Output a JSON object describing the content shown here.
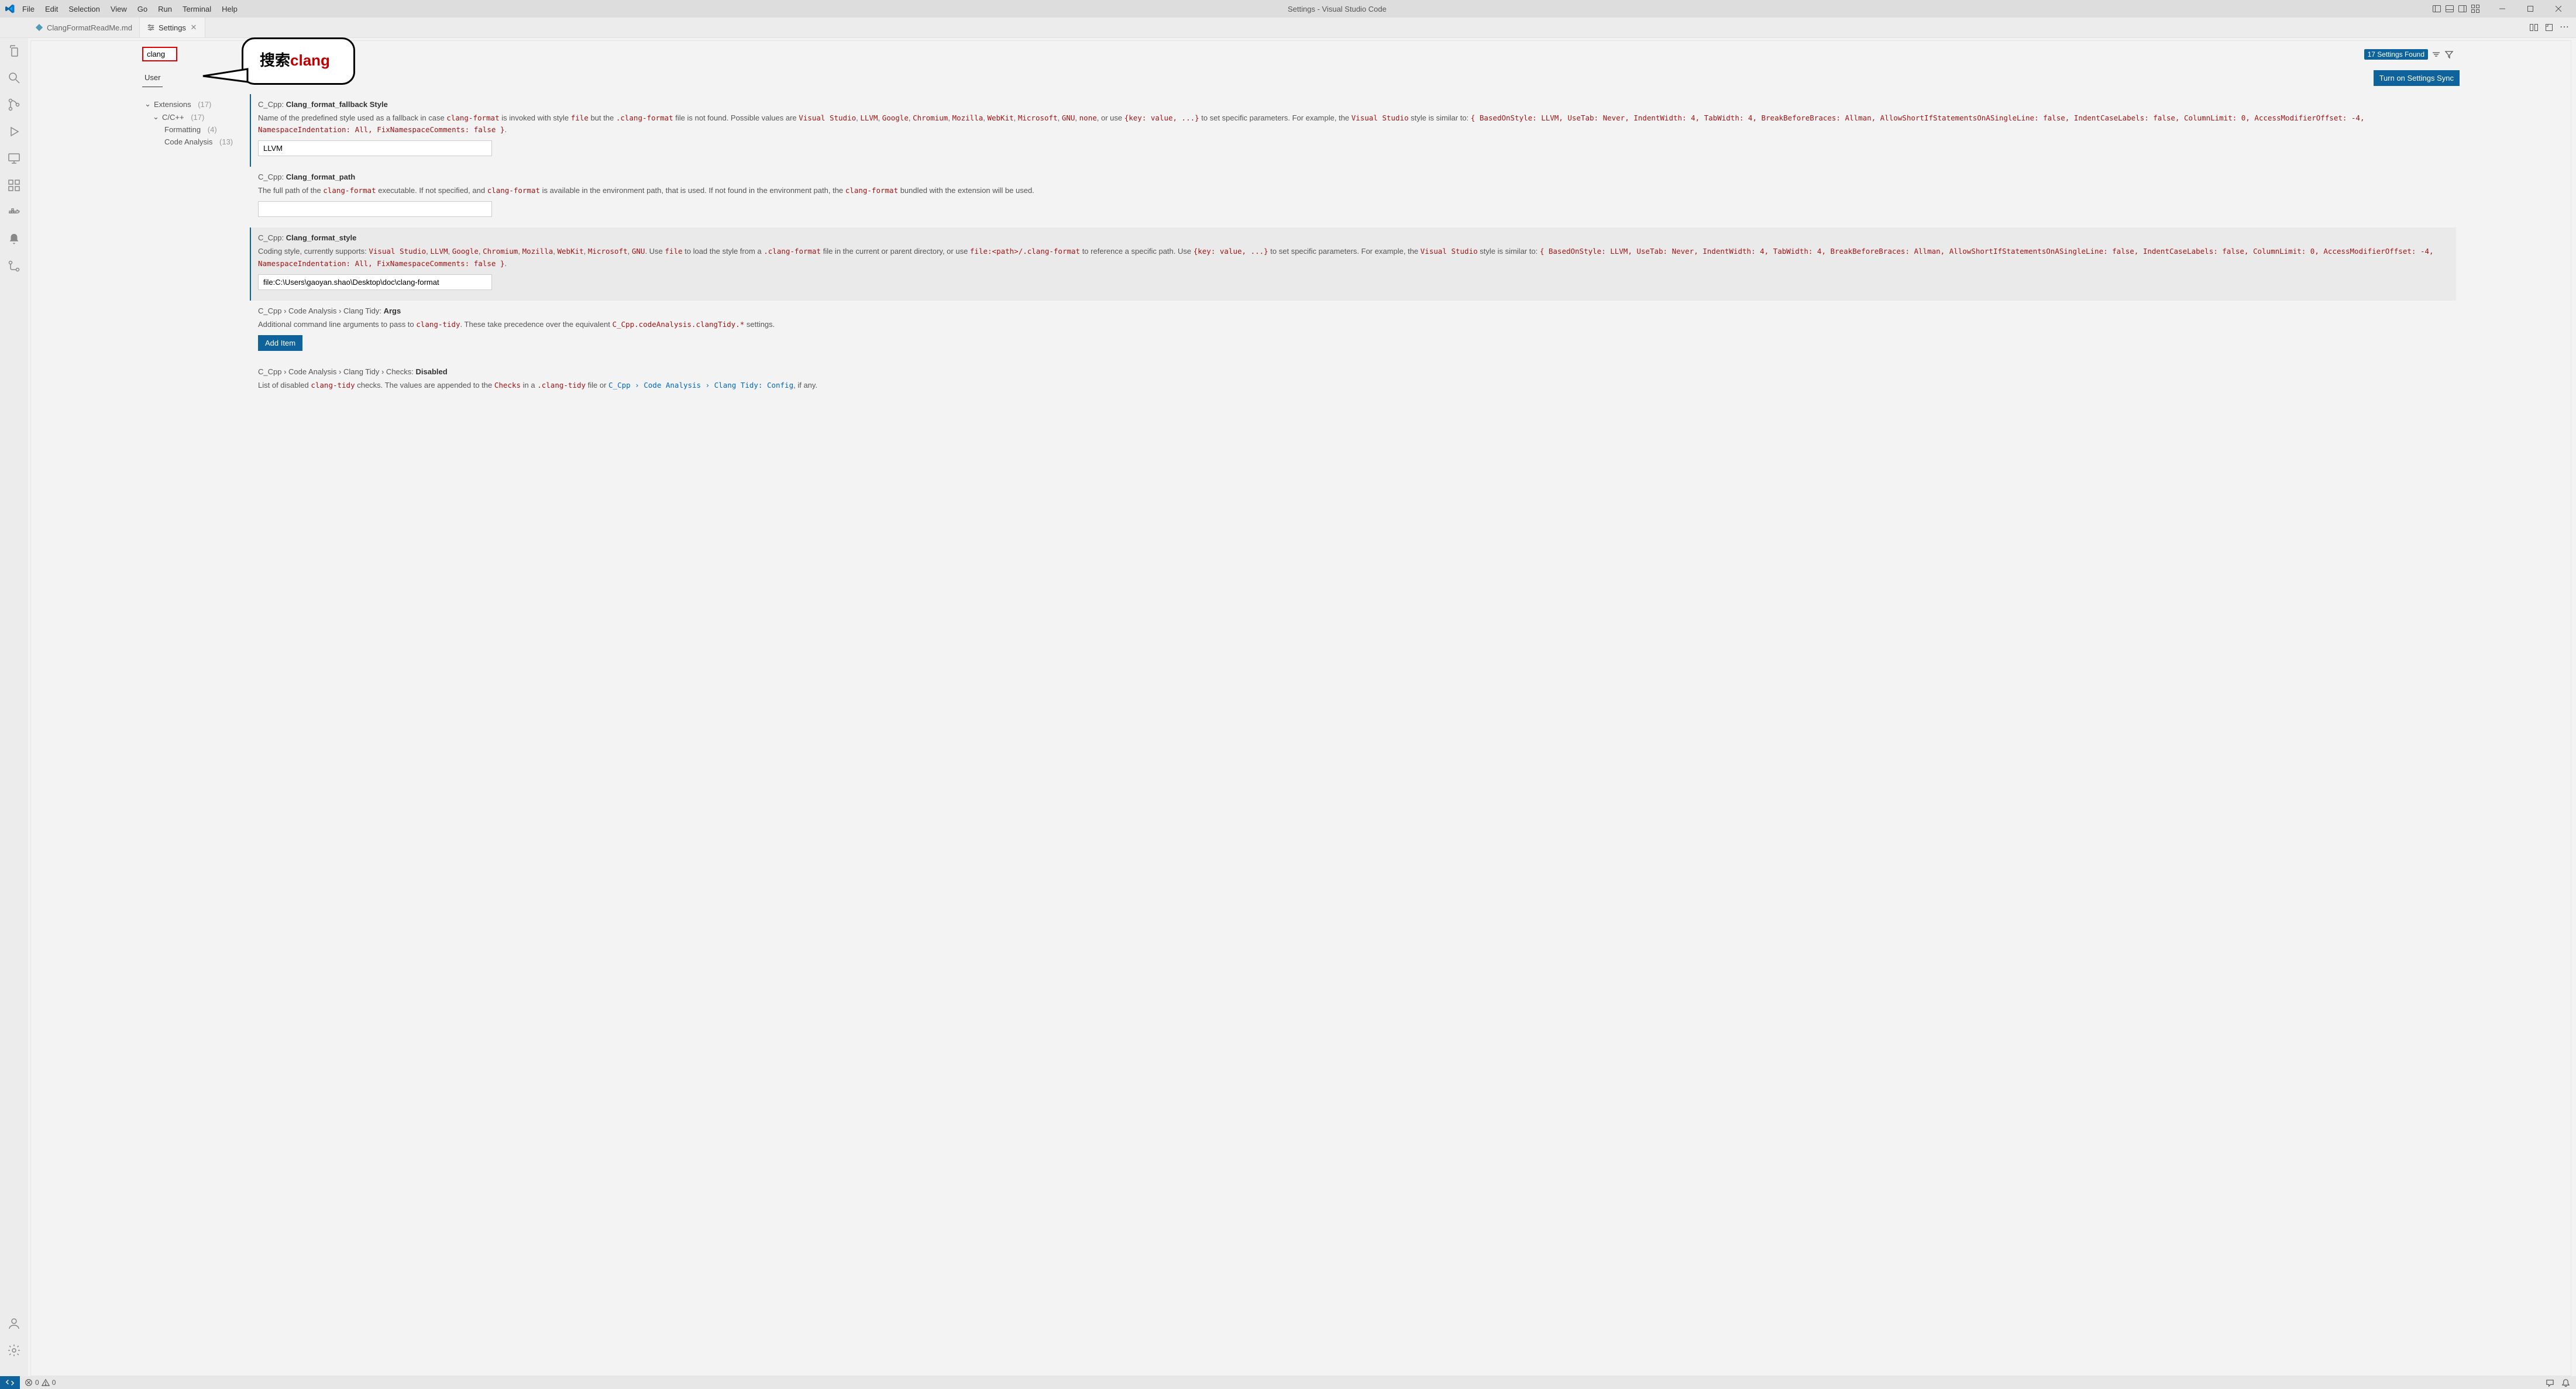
{
  "title_bar": {
    "menu": [
      "File",
      "Edit",
      "Selection",
      "View",
      "Go",
      "Run",
      "Terminal",
      "Help"
    ],
    "window_title": "Settings - Visual Studio Code"
  },
  "tabs": {
    "items": [
      {
        "label": "ClangFormatReadMe.md",
        "active": false
      },
      {
        "label": "Settings",
        "active": true
      }
    ]
  },
  "callout": {
    "prefix": "搜索",
    "keyword": "clang"
  },
  "search": {
    "value": "clang",
    "found_label": "17 Settings Found"
  },
  "scope": {
    "user": "User",
    "sync_button": "Turn on Settings Sync"
  },
  "tree": {
    "extensions": {
      "label": "Extensions",
      "count": "(17)"
    },
    "ccpp": {
      "label": "C/C++",
      "count": "(17)"
    },
    "formatting": {
      "label": "Formatting",
      "count": "(4)"
    },
    "code_analysis": {
      "label": "Code Analysis",
      "count": "(13)"
    }
  },
  "settings": {
    "s1": {
      "scope": "C_Cpp:",
      "name": "Clang_format_fallback Style",
      "desc_pre": "Name of the predefined style used as a fallback in case ",
      "c_clang_format": "clang-format",
      "desc_2": " is invoked with style ",
      "c_file": "file",
      "desc_3": " but the ",
      "c_clang_format2": ".clang-format",
      "desc_4": " file is not found. Possible values are ",
      "v_vs": "Visual Studio",
      "v_llvm": "LLVM",
      "v_google": "Google",
      "v_chromium": "Chromium",
      "v_mozilla": "Mozilla",
      "v_webkit": "WebKit",
      "v_ms": "Microsoft",
      "v_gnu": "GNU",
      "v_none": "none",
      "desc_5": ", or use ",
      "c_kv": "{key: value, ...}",
      "desc_6": " to set specific parameters. For example, the ",
      "v_vs2": "Visual Studio",
      "desc_7": " style is similar to: ",
      "c_style": "{ BasedOnStyle: LLVM, UseTab: Never, IndentWidth: 4, TabWidth: 4, BreakBeforeBraces: Allman, AllowShortIfStatementsOnASingleLine: false, IndentCaseLabels: false, ColumnLimit: 0, AccessModifierOffset: -4, NamespaceIndentation: All, FixNamespaceComments: false }",
      "desc_end": ".",
      "value": "LLVM"
    },
    "s2": {
      "scope": "C_Cpp:",
      "name": "Clang_format_path",
      "d1": "The full path of the ",
      "c1": "clang-format",
      "d2": " executable. If not specified, and ",
      "c2": "clang-format",
      "d3": " is available in the environment path, that is used. If not found in the environment path, the ",
      "c3": "clang-format",
      "d4": " bundled with the extension will be used.",
      "value": ""
    },
    "s3": {
      "scope": "C_Cpp:",
      "name": "Clang_format_style",
      "d1": "Coding style, currently supports: ",
      "v_vs": "Visual Studio",
      "v_llvm": "LLVM",
      "v_google": "Google",
      "v_chromium": "Chromium",
      "v_mozilla": "Mozilla",
      "v_webkit": "WebKit",
      "v_ms": "Microsoft",
      "v_gnu": "GNU",
      "d2": ". Use ",
      "c_file": "file",
      "d3": " to load the style from a ",
      "c_cf": ".clang-format",
      "d4": " file in the current or parent directory, or use ",
      "c_fp": "file:<path>/.clang-format",
      "d5": " to reference a specific path. Use ",
      "c_kv": "{key: value, ...}",
      "d6": " to set specific parameters. For example, the ",
      "v_vs2": "Visual Studio",
      "d7": " style is similar to: ",
      "c_style": "{ BasedOnStyle: LLVM, UseTab: Never, IndentWidth: 4, TabWidth: 4, BreakBeforeBraces: Allman, AllowShortIfStatementsOnASingleLine: false, IndentCaseLabels: false, ColumnLimit: 0, AccessModifierOffset: -4, NamespaceIndentation: All, FixNamespaceComments: false }",
      "d_end": ".",
      "value": "file:C:\\Users\\gaoyan.shao\\Desktop\\doc\\clang-format"
    },
    "s4": {
      "scope": "C_Cpp › ",
      "crumb": "Code Analysis › Clang Tidy: ",
      "name": "Args",
      "d1": "Additional command line arguments to pass to ",
      "c1": "clang-tidy",
      "d2": ". These take precedence over the equivalent ",
      "c2": "C_Cpp.codeAnalysis.clangTidy.*",
      "d3": " settings.",
      "button": "Add Item"
    },
    "s5": {
      "scope": "C_Cpp › ",
      "crumb": "Code Analysis › Clang Tidy › Checks: ",
      "name": "Disabled",
      "d1": "List of disabled ",
      "c1": "clang-tidy",
      "d2": " checks. The values are appended to the ",
      "c2": "Checks",
      "d3": " in a ",
      "c3": ".clang-tidy",
      "d4": " file or ",
      "link": "C_Cpp › Code Analysis › Clang Tidy: Config",
      "d5": ", if any."
    }
  },
  "status": {
    "errors": "0",
    "warnings": "0"
  }
}
